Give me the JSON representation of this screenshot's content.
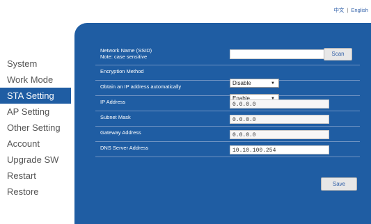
{
  "language_bar": {
    "chinese": "中文",
    "separator": "|",
    "english": "English"
  },
  "sidebar": {
    "items": [
      {
        "label": "System",
        "active": false
      },
      {
        "label": "Work Mode",
        "active": false
      },
      {
        "label": "STA Setting",
        "active": true
      },
      {
        "label": "AP Setting",
        "active": false
      },
      {
        "label": "Other Setting",
        "active": false
      },
      {
        "label": "Account",
        "active": false
      },
      {
        "label": "Upgrade SW",
        "active": false
      },
      {
        "label": "Restart",
        "active": false
      },
      {
        "label": "Restore",
        "active": false
      }
    ]
  },
  "form": {
    "ssid": {
      "label": "Network Name  (SSID)",
      "note": "Note: case sensitive",
      "value": ""
    },
    "scan_label": "Scan",
    "encryption": {
      "label": "Encryption Method",
      "value": "Disable"
    },
    "obtain_ip": {
      "label": "Obtain an IP address automatically",
      "value": "Enable"
    },
    "ip_address": {
      "label": "IP Address",
      "value": "0.0.0.0"
    },
    "subnet_mask": {
      "label": "Subnet Mask",
      "value": "0.0.0.0"
    },
    "gateway": {
      "label": "Gateway Address",
      "value": "0.0.0.0"
    },
    "dns": {
      "label": "DNS Server Address",
      "value": "10.10.100.254"
    },
    "save_label": "Save"
  },
  "colors": {
    "panel": "#1f5da3",
    "active_nav": "#1f5da3",
    "link": "#2f5fa8"
  },
  "icons": {
    "select_caret": "triangle-down-icon"
  }
}
